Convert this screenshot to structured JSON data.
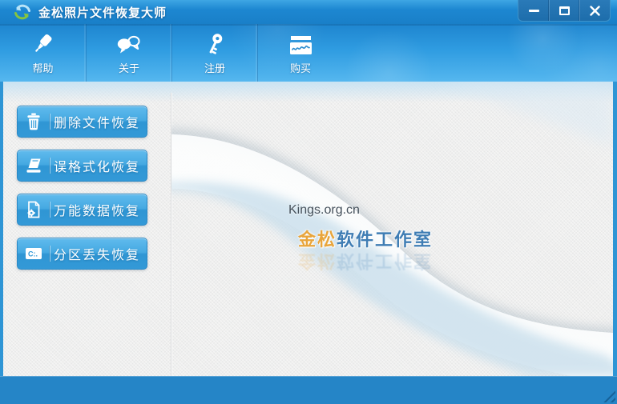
{
  "window": {
    "title": "金松照片文件恢复大师",
    "logo_icon": "sync-arrows-logo",
    "controls": [
      {
        "name": "minimize-button",
        "icon": "minimize-icon"
      },
      {
        "name": "maximize-button",
        "icon": "maximize-icon"
      },
      {
        "name": "close-button",
        "icon": "close-icon"
      }
    ]
  },
  "toolbar": {
    "items": [
      {
        "label": "帮助",
        "icon": "marker-pen-icon"
      },
      {
        "label": "关于",
        "icon": "chat-bubbles-icon"
      },
      {
        "label": "注册",
        "icon": "key-icon"
      },
      {
        "label": "购买",
        "icon": "bank-card-icon"
      }
    ]
  },
  "sidebar": {
    "buttons": [
      {
        "label": "删除文件恢复",
        "icon": "trash-icon"
      },
      {
        "label": "误格式化恢复",
        "icon": "format-disk-icon"
      },
      {
        "label": "万能数据恢复",
        "icon": "document-gear-icon"
      },
      {
        "label": "分区丢失恢复",
        "icon": "drive-partition-icon",
        "icon_text": "C:."
      }
    ]
  },
  "main": {
    "watermark_site": "Kings.org.cn",
    "brand_gold": "金松",
    "brand_blue": "软件工作室"
  },
  "colors": {
    "titlebar_blue": "#1d87d1",
    "toolbar_blue": "#2f9ce1",
    "button_blue": "#45a9e2",
    "footer_blue": "#2585c7",
    "body_bg": "#efefee",
    "brand_gold_color": "#e8a53c",
    "brand_blue_color": "#3f7db4"
  }
}
